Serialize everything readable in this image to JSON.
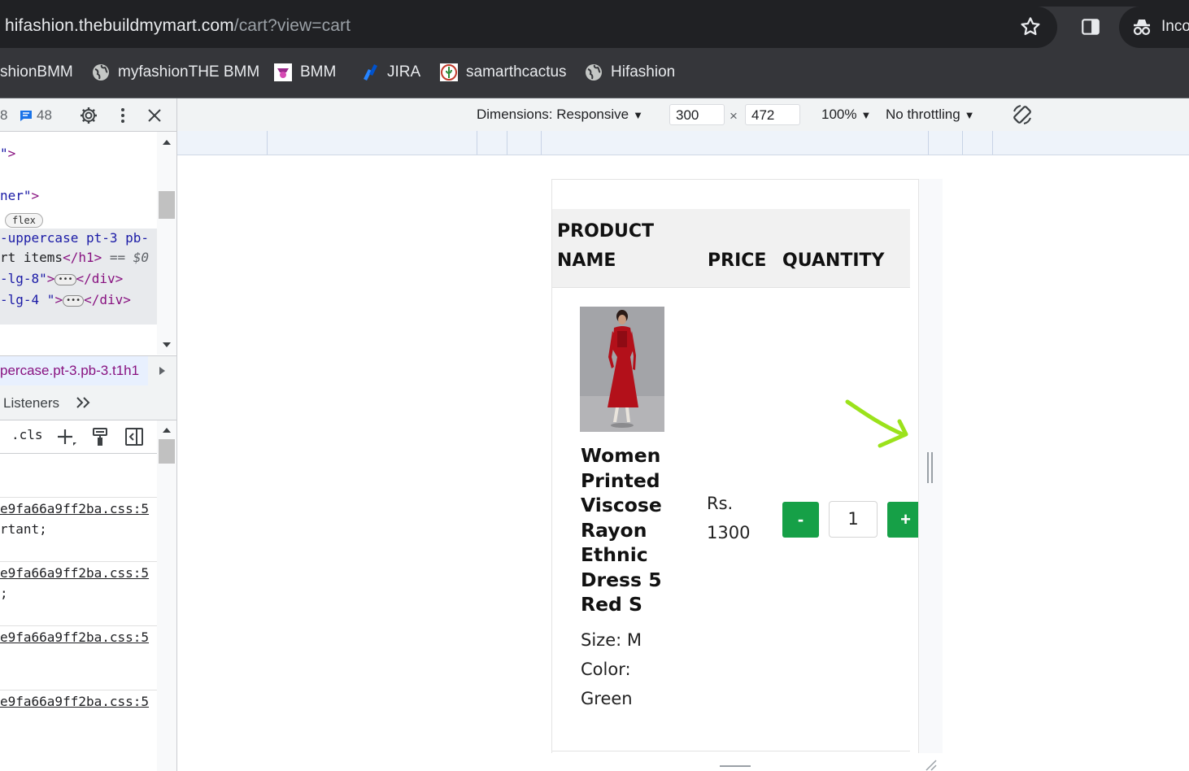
{
  "browser": {
    "url_host": "hifashion.thebuildmymart.com",
    "url_path": "/cart?view=cart",
    "profile_label": "Inco",
    "bookmarks": [
      {
        "label": "shionBMM",
        "icon": "none"
      },
      {
        "label": "myfashionTHE BMM",
        "icon": "globe-icon"
      },
      {
        "label": "BMM",
        "icon": "bmm-logo-icon"
      },
      {
        "label": "JIRA",
        "icon": "jira-icon"
      },
      {
        "label": "samarthcactus",
        "icon": "cactus-icon"
      },
      {
        "label": "Hifashion",
        "icon": "globe-icon"
      }
    ]
  },
  "devtools": {
    "issues_count_prefix": "8",
    "messages_count": "48",
    "code_lines": {
      "l1_str": "\"",
      "l1_tag": ">",
      "l2_str": "ner\"",
      "l2_tag": ">",
      "l3_badge": "flex",
      "l4_str": "-uppercase pt-3 pb-",
      "l5_text": "rt items",
      "l5_tag": "</h1>",
      "l5_eq": "== $0",
      "l6_str": "-lg-8\"",
      "l6_tag_open": ">",
      "l6_tag_close": "</div>",
      "l7_str": "-lg-4  \"",
      "l7_tag_open": ">",
      "l7_tag_close": "</div>"
    },
    "breadcrumb": "percase.pt-3.pb-3.t1h1",
    "tabs_label": "Listeners",
    "styles_cls": ".cls",
    "css_link": "e9fa66a9ff2ba.css:5",
    "rule1_text": "rtant;",
    "rule2_text": ";"
  },
  "device_toolbar": {
    "dimensions_label": "Dimensions: Responsive",
    "width": "300",
    "times": "×",
    "height": "472",
    "zoom": "100%",
    "throttling": "No throttling"
  },
  "cart": {
    "headers": {
      "product_line1": "PRODUCT",
      "product_line2": "NAME",
      "price": "PRICE",
      "quantity": "QUANTITY"
    },
    "item": {
      "name": "Women Printed Viscose Rayon Ethnic Dress 5 Red S",
      "size": "Size: M",
      "color_label": "Color:",
      "color_value": "Green",
      "price_prefix": "Rs.",
      "price_value": "1300",
      "quantity": "1",
      "minus_label": "-",
      "plus_label": "+"
    }
  },
  "colors": {
    "qty_button": "#16a047",
    "annotation_arrow": "#9be21b"
  }
}
